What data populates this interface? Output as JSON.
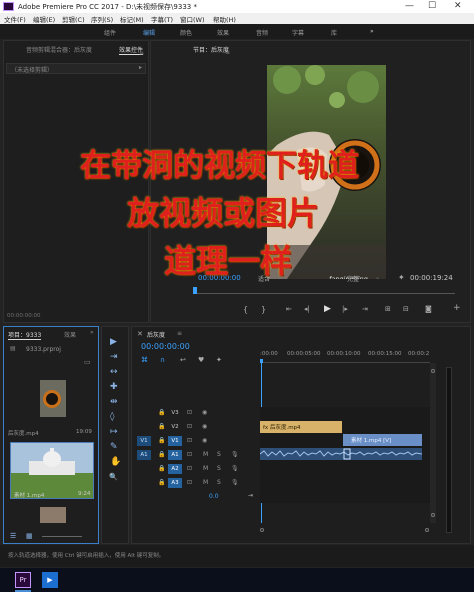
{
  "window": {
    "title": "Adobe Premiere Pro CC 2017 - D:\\未视频保存\\9333 *",
    "controls": [
      "—",
      "☐",
      "✕"
    ]
  },
  "menu": [
    "文件(F)",
    "编辑(E)",
    "剪辑(C)",
    "序列(S)",
    "标记(M)",
    "字幕(T)",
    "窗口(W)",
    "帮助(H)"
  ],
  "workspaces": {
    "items": [
      "组件",
      "编辑",
      "颜色",
      "效果",
      "音频",
      "字幕",
      "库"
    ],
    "active": 1,
    "more": "»"
  },
  "source_panel": {
    "tabs": [
      "音频剪辑混合器：后灰度",
      "效果控件"
    ],
    "active_tab": 1,
    "menu_icon": "≡",
    "clip_selector": "（未选择剪辑）",
    "timecode": "00:00:00:00"
  },
  "program_monitor": {
    "tab": "节目：后灰度",
    "menu_icon": "≡",
    "watermark": "fangingqing",
    "timecode": "00:00:00:00",
    "fit": "适合",
    "quality": "完整",
    "duration": "00:00:19:24"
  },
  "overlay_text": [
    "在带洞的视频下轨道",
    "放视频或图片",
    "道理一样"
  ],
  "project_panel": {
    "tabs": [
      "项目：9333",
      "效果"
    ],
    "more": "»",
    "file": "9333.prproj",
    "items": [
      {
        "name": "后灰度.mp4",
        "duration": "19:09"
      },
      {
        "name": "素材 1.mp4",
        "duration": "9:24"
      }
    ]
  },
  "tools": [
    "▶",
    "⇥",
    "↔",
    "✚",
    "⇹",
    "◊",
    "↦",
    "✎",
    "✋",
    "🔍"
  ],
  "timeline": {
    "tab": "后灰度",
    "menu_icon": "≡",
    "timecode": "00:00:00:00",
    "ruler": [
      ":00:00",
      "00:00:05:00",
      "00:00:10:00",
      "00:00:15:00",
      "00:00:2"
    ],
    "tracks": [
      {
        "src": "",
        "name": "V3",
        "btn": "⊡",
        "eye": "◉",
        "m": "",
        "s": ""
      },
      {
        "src": "",
        "name": "V2",
        "btn": "⊡",
        "eye": "◉",
        "m": "",
        "s": ""
      },
      {
        "src": "V1",
        "name": "V1",
        "btn": "⊡",
        "eye": "◉",
        "m": "",
        "s": ""
      },
      {
        "src": "A1",
        "name": "A1",
        "btn": "⊡",
        "eye": "",
        "m": "M",
        "s": "S"
      },
      {
        "src": "",
        "name": "A2",
        "btn": "⊡",
        "eye": "",
        "m": "M",
        "s": "S"
      },
      {
        "src": "",
        "name": "A3",
        "btn": "⊡",
        "eye": "",
        "m": "M",
        "s": "S"
      }
    ],
    "master_value": "0.0",
    "clips": [
      {
        "label": "fx 后灰度.mp4",
        "track": "V2"
      },
      {
        "label": "素材 1.mp4 [V]",
        "track": "V1"
      }
    ]
  },
  "status_bar": "按入轨道选择器，使用 Ctrl 键可启用插入，使用 Alt 键可复制。",
  "taskbar": [
    "Pr",
    "▶"
  ],
  "colors": {
    "accent": "#2d8ceb",
    "overlay_text": "#e0201c",
    "clip_v2": "#d9b26a",
    "clip_v1": "#6a8fc7"
  }
}
